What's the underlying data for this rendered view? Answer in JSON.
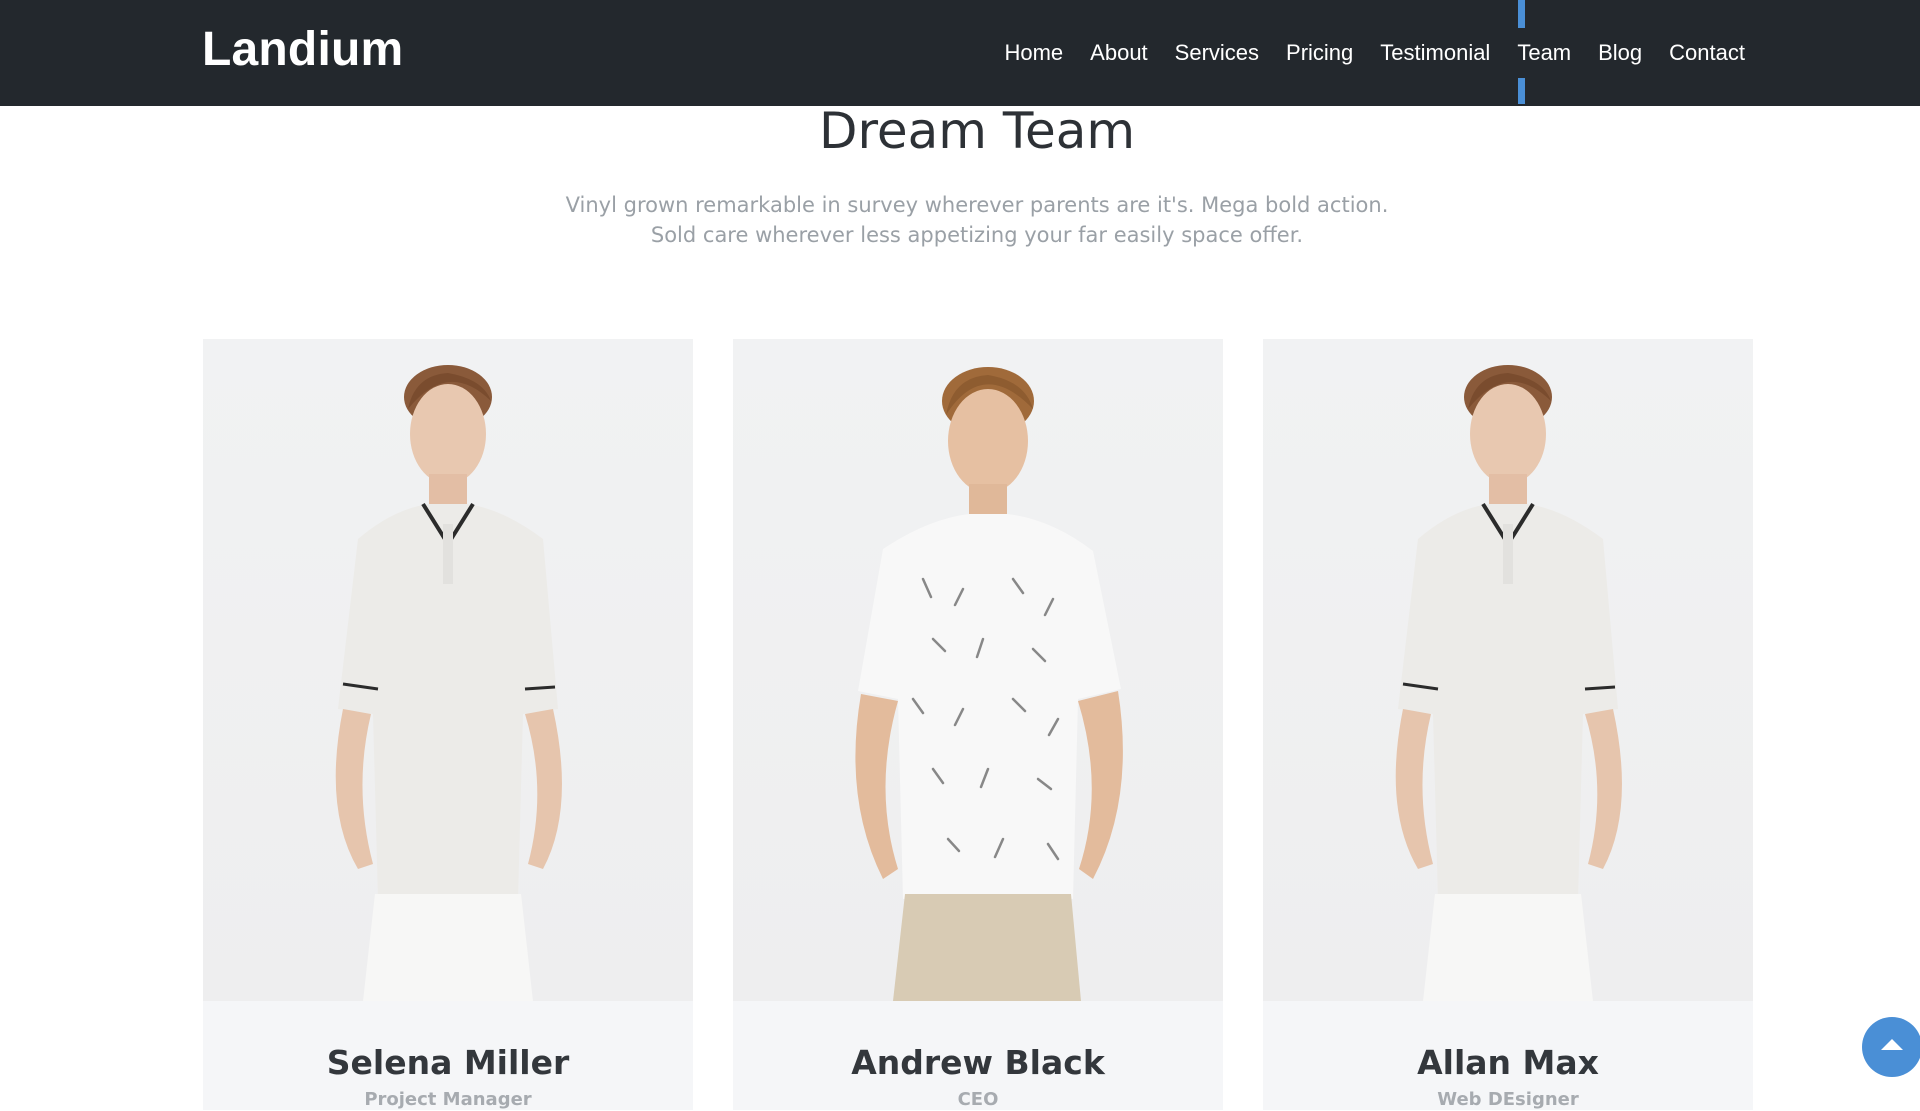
{
  "navbar": {
    "brand": "Landium",
    "items": [
      {
        "label": "Home",
        "active": false
      },
      {
        "label": "About",
        "active": false
      },
      {
        "label": "Services",
        "active": false
      },
      {
        "label": "Pricing",
        "active": false
      },
      {
        "label": "Testimonial",
        "active": false
      },
      {
        "label": "Team",
        "active": true
      },
      {
        "label": "Blog",
        "active": false
      },
      {
        "label": "Contact",
        "active": false
      }
    ],
    "accent_color": "#4a8fd6",
    "background_color": "#23282d"
  },
  "team_section": {
    "title": "Dream Team",
    "description_line1": "Vinyl grown remarkable in survey wherever parents are it's. Mega bold action.",
    "description_line2": "Sold care wherever less appetizing your far easily space offer.",
    "members": [
      {
        "name": "Selena Miller",
        "role": "Project Manager",
        "photo": "man-polo-shirt-photo"
      },
      {
        "name": "Andrew Black",
        "role": "CEO",
        "photo": "man-patterned-tshirt-photo"
      },
      {
        "name": "Allan Max",
        "role": "Web DEsigner",
        "photo": "man-polo-shirt-photo"
      }
    ]
  },
  "back_to_top": {
    "icon": "arrow-up-icon",
    "color": "#4a8fd6"
  }
}
